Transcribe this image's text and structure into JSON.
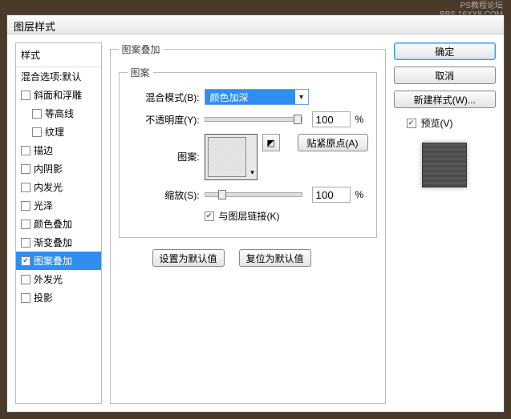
{
  "watermark": {
    "line1": "PS教程论坛",
    "line2": "BBS.16XX8.COM"
  },
  "window": {
    "title": "图层样式"
  },
  "sidebar": {
    "header": "样式",
    "blend_options": "混合选项:默认",
    "items": [
      {
        "label": "斜面和浮雕",
        "checked": false
      },
      {
        "label": "等高线",
        "checked": false,
        "indent": true
      },
      {
        "label": "纹理",
        "checked": false,
        "indent": true
      },
      {
        "label": "描边",
        "checked": false
      },
      {
        "label": "内阴影",
        "checked": false
      },
      {
        "label": "内发光",
        "checked": false
      },
      {
        "label": "光泽",
        "checked": false
      },
      {
        "label": "颜色叠加",
        "checked": false
      },
      {
        "label": "渐变叠加",
        "checked": false
      },
      {
        "label": "图案叠加",
        "checked": true,
        "selected": true
      },
      {
        "label": "外发光",
        "checked": false
      },
      {
        "label": "投影",
        "checked": false
      }
    ]
  },
  "panel": {
    "outer_title": "图案叠加",
    "inner_title": "图案",
    "blend_mode_label": "混合模式(B):",
    "blend_mode_value": "颜色加深",
    "opacity_label": "不透明度(Y):",
    "opacity_value": "100",
    "percent": "%",
    "pattern_label": "图案:",
    "snap_origin": "贴紧原点(A)",
    "scale_label": "缩放(S):",
    "scale_value": "100",
    "link_label": "与图层链接(K)",
    "link_checked": true,
    "make_default": "设置为默认值",
    "reset_default": "复位为默认值"
  },
  "right": {
    "ok": "确定",
    "cancel": "取消",
    "new_style": "新建样式(W)...",
    "preview_label": "预览(V)",
    "preview_checked": true
  }
}
